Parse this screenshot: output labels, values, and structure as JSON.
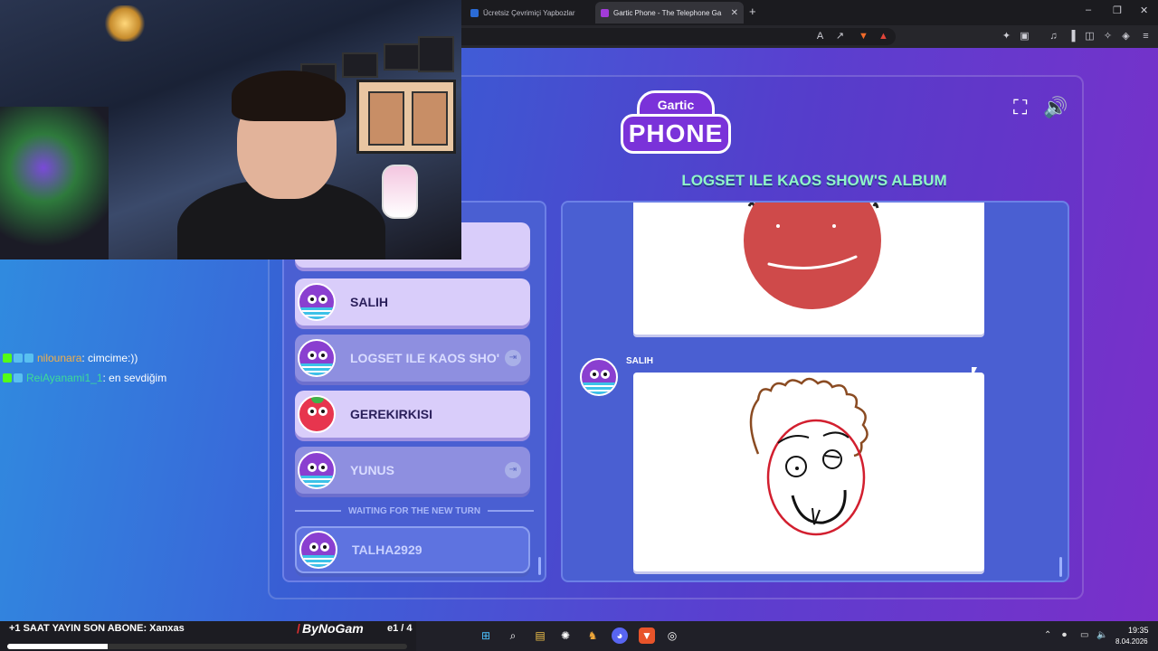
{
  "browser": {
    "tabs": [
      {
        "title": "Ücretsiz Çevrimiçi Yapbozlar",
        "active": false
      },
      {
        "title": "Gartic Phone - The Telephone Ga",
        "active": true
      }
    ],
    "new_tab": "+",
    "window_controls": [
      "–",
      "❐",
      "✕"
    ]
  },
  "game": {
    "logo_top": "Gartic",
    "logo_main": "PHONE",
    "album_title": "LOGSET ILE KAOS SHOW'S ALBUM",
    "players": [
      {
        "name": "SALIH",
        "state": "active",
        "avatar": "bird"
      },
      {
        "name": "LOGSET ILE KAOS SHO'",
        "state": "dim",
        "avatar": "bird"
      },
      {
        "name": "GEREKIRKISI",
        "state": "active",
        "avatar": "berry"
      },
      {
        "name": "YUNUS",
        "state": "dim",
        "avatar": "bird"
      },
      {
        "name": "TALHA2929",
        "state": "waiting",
        "avatar": "bird"
      }
    ],
    "waiting_label": "WAITING FOR THE NEW TURN",
    "album_author": "SALIH"
  },
  "chat": [
    {
      "user": "nilounara",
      "message": " : cimcime:))",
      "user_color": "#f2b04a"
    },
    {
      "user": "ReiAyanami1_1",
      "message": " : en sevdiğim",
      "user_color": "#3ddc97"
    }
  ],
  "stream_bar": {
    "sub_text": "+1 SAAT YAYIN  SON ABONE: Xanxas",
    "brand": "ByNoGam",
    "page_counter": "e1 / 4",
    "progress": 0.25
  },
  "taskbar": {
    "time": "19:35",
    "date": "8.04.2026"
  },
  "colors": {
    "title_accent": "#8ff5c8",
    "panel_bg": "#4a5fd2"
  }
}
